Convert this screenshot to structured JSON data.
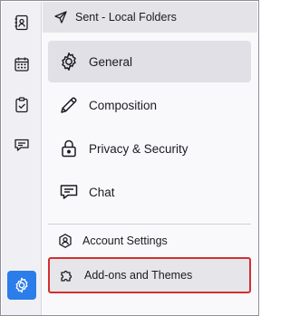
{
  "folder_header": {
    "title": "Sent - Local Folders",
    "icon": "send-icon"
  },
  "spaces": [
    {
      "name": "address-book",
      "icon": "address-book-icon"
    },
    {
      "name": "calendar",
      "icon": "calendar-icon"
    },
    {
      "name": "tasks",
      "icon": "tasks-icon"
    },
    {
      "name": "chat",
      "icon": "chat-icon"
    },
    {
      "name": "settings",
      "icon": "gear-icon",
      "active": true
    }
  ],
  "categories": [
    {
      "label": "General",
      "icon": "gear-icon",
      "selected": true
    },
    {
      "label": "Composition",
      "icon": "pencil-icon"
    },
    {
      "label": "Privacy & Security",
      "icon": "lock-icon"
    },
    {
      "label": "Chat",
      "icon": "chat-icon"
    }
  ],
  "footer_items": [
    {
      "label": "Account Settings",
      "icon": "account-icon"
    },
    {
      "label": "Add-ons and Themes",
      "icon": "puzzle-icon",
      "highlighted": true
    }
  ],
  "colors": {
    "accent": "#2b7de9",
    "highlight_border": "#d32f2f",
    "selected_bg": "#e0e0e6"
  }
}
